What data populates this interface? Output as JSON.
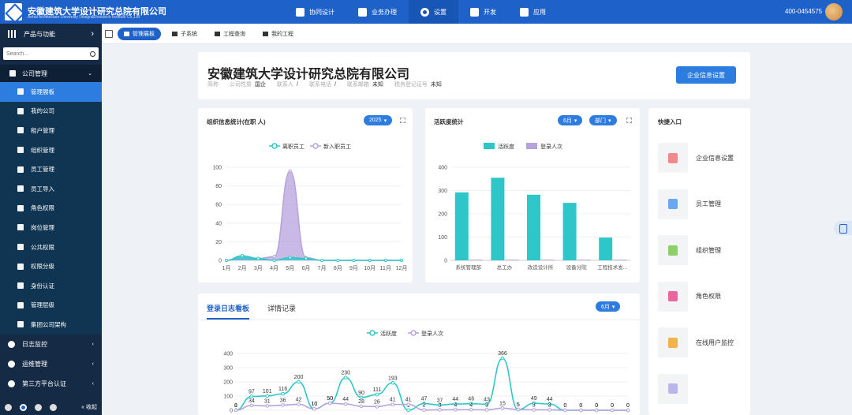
{
  "header": {
    "company_cn": "安徽建筑大学设计研究总院有限公司",
    "company_en": "Anhui Architecture University Design&Research Institute Co.,Ltd",
    "nav": [
      {
        "label": "协同设计",
        "icon": "apps-icon"
      },
      {
        "label": "业务办理",
        "icon": "fan-icon"
      },
      {
        "label": "设置",
        "icon": "gear-icon",
        "active": true
      },
      {
        "label": "开发",
        "icon": "tools-icon"
      },
      {
        "label": "应用",
        "icon": "cube-icon"
      }
    ],
    "phone": "400-0454575"
  },
  "sidebar": {
    "top_label": "产品与功能",
    "search_placeholder": "Search...",
    "group_label": "公司管理",
    "items": [
      {
        "label": "管理展板",
        "active": true
      },
      {
        "label": "我的公司"
      },
      {
        "label": "租户管理"
      },
      {
        "label": "组织管理"
      },
      {
        "label": "员工管理"
      },
      {
        "label": "员工导入"
      },
      {
        "label": "角色权限"
      },
      {
        "label": "岗位管理"
      },
      {
        "label": "公共权限"
      },
      {
        "label": "权限分级"
      },
      {
        "label": "身份认证"
      },
      {
        "label": "管理层级"
      },
      {
        "label": "集团公司架构"
      }
    ],
    "groups": [
      "日志监控",
      "运维管理",
      "第三方平台认证"
    ],
    "collapse_label": "收起"
  },
  "tabbar": {
    "tabs": [
      {
        "label": "管理展板",
        "active": true
      },
      {
        "label": "子系统"
      },
      {
        "label": "工程查询"
      },
      {
        "label": "我的工程"
      }
    ]
  },
  "company": {
    "name": "安徽建筑大学设计研究总院有限公司",
    "abbr_label": "简称",
    "nature_label": "公司性质",
    "nature_value": "国企",
    "contact_label": "联系人",
    "contact_value": "/",
    "phone_label": "联系电话",
    "phone_value": "/",
    "email_label": "联系邮箱",
    "email_value": "未知",
    "tax_label": "税务登记证号",
    "tax_value": "未知",
    "settings_button": "企业信息设置"
  },
  "stat_card": {
    "title": "组织信息统计(在职 人)",
    "year": "2025",
    "legend_left": "离职员工",
    "legend_right": "新入职员工"
  },
  "act_card": {
    "title": "活跃度统计",
    "month": "6月",
    "dept": "部门",
    "legend_left": "活跃度",
    "legend_right": "登录人次"
  },
  "quick": {
    "title": "快捷入口",
    "items": [
      {
        "label": "企业信息设置",
        "icon": "clipboard-icon",
        "color": "#f08a8a"
      },
      {
        "label": "员工管理",
        "icon": "user-icon",
        "color": "#6aa6f3"
      },
      {
        "label": "组织管理",
        "icon": "org-icon",
        "color": "#8dd06a"
      },
      {
        "label": "角色权限",
        "icon": "key-icon",
        "color": "#e9679f"
      },
      {
        "label": "在线用户监控",
        "icon": "monitor-icon",
        "color": "#f4b24a"
      },
      {
        "label": "",
        "icon": "blurred-icon",
        "color": "#b9b6ea"
      }
    ]
  },
  "log_card": {
    "tab_active": "登录日志看板",
    "tab_other": "详情记录",
    "month": "6月",
    "legend_left": "活跃度",
    "legend_right": "登录人次"
  },
  "colors": {
    "primary": "#1e62c9",
    "teal": "#2ec7c9",
    "purple": "#b6a2de"
  },
  "chart_data": [
    {
      "type": "area",
      "title": "组织信息统计(在职 人)",
      "categories": [
        "1月",
        "2月",
        "3月",
        "4月",
        "5月",
        "6月",
        "7月",
        "8月",
        "9月",
        "10月",
        "11月",
        "12月"
      ],
      "series": [
        {
          "name": "离职员工",
          "values": [
            0,
            5,
            2,
            0,
            3,
            2,
            0,
            0,
            0,
            0,
            0,
            0
          ]
        },
        {
          "name": "新入职员工",
          "values": [
            0,
            3,
            2,
            4,
            96,
            3,
            0,
            0,
            0,
            0,
            0,
            0
          ]
        }
      ],
      "ylim": [
        0,
        100
      ],
      "yticks": [
        0,
        20,
        40,
        60,
        80,
        100
      ]
    },
    {
      "type": "bar",
      "title": "活跃度统计",
      "categories": [
        "系统管理部",
        "总工办",
        "改造设计所",
        "设备分院",
        "工程技术发..."
      ],
      "series": [
        {
          "name": "活跃度",
          "values": [
            292,
            355,
            282,
            247,
            98
          ]
        },
        {
          "name": "登录人次",
          "values": [
            3,
            3,
            3,
            3,
            3
          ]
        }
      ],
      "ylim": [
        0,
        400
      ],
      "yticks": [
        0,
        100,
        200,
        300,
        400
      ]
    },
    {
      "type": "line",
      "title": "登录日志看板",
      "series": [
        {
          "name": "活跃度",
          "values": [
            1,
            97,
            101,
            116,
            200,
            10,
            50,
            230,
            90,
            111,
            193,
            1,
            47,
            37,
            44,
            46,
            43,
            366,
            5,
            49,
            44,
            0,
            0,
            0,
            0,
            0
          ]
        },
        {
          "name": "登录人次",
          "values": [
            0,
            34,
            31,
            36,
            42,
            10,
            50,
            44,
            28,
            26,
            41,
            41,
            2,
            3,
            4,
            4,
            3,
            15,
            5,
            3,
            3,
            0,
            0,
            0,
            0,
            0
          ]
        }
      ],
      "ylim": [
        0,
        400
      ],
      "yticks": [
        0,
        100,
        200,
        300,
        400
      ]
    }
  ]
}
